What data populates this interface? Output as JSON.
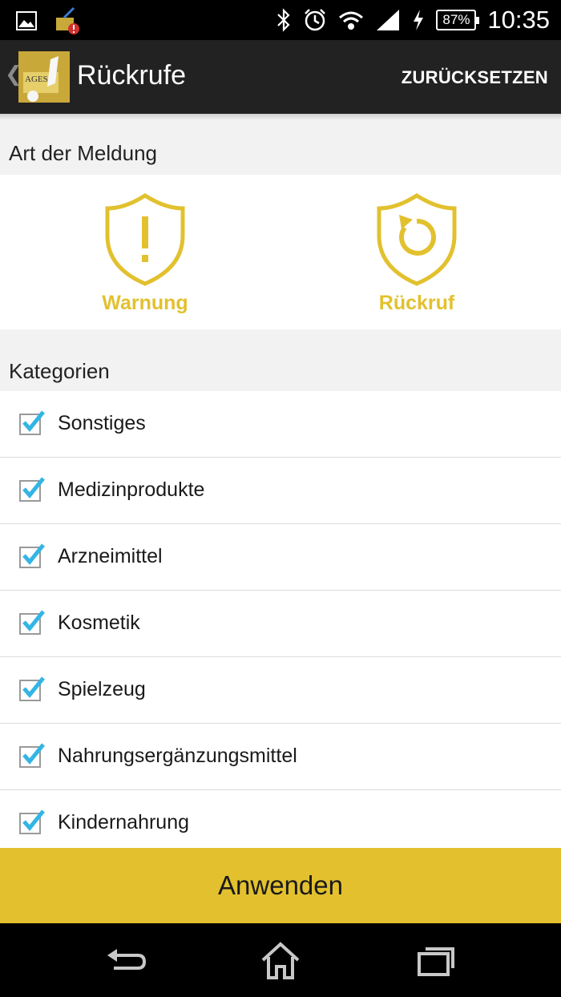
{
  "status_bar": {
    "battery": "87%",
    "time": "10:35",
    "icons": [
      "image-icon",
      "cleaner-icon",
      "bluetooth-icon",
      "alarm-icon",
      "wifi-icon",
      "signal-icon",
      "charging-icon",
      "battery-icon"
    ]
  },
  "action_bar": {
    "logo_text": "AGES",
    "title": "Rückrufe",
    "reset_label": "ZURÜCKSETZEN"
  },
  "report_type": {
    "header": "Art der Meldung",
    "options": [
      {
        "label": "Warnung",
        "icon": "warning-shield-icon"
      },
      {
        "label": "Rückruf",
        "icon": "recall-shield-icon"
      }
    ]
  },
  "categories": {
    "header": "Kategorien",
    "items": [
      {
        "label": "Sonstiges",
        "checked": true
      },
      {
        "label": "Medizinprodukte",
        "checked": true
      },
      {
        "label": "Arzneimittel",
        "checked": true
      },
      {
        "label": "Kosmetik",
        "checked": true
      },
      {
        "label": "Spielzeug",
        "checked": true
      },
      {
        "label": "Nahrungsergänzungsmittel",
        "checked": true
      },
      {
        "label": "Kindernahrung",
        "checked": true
      }
    ]
  },
  "apply_label": "Anwenden",
  "colors": {
    "accent": "#e3c12e",
    "check": "#33b5e5",
    "action_bar": "#222222"
  }
}
